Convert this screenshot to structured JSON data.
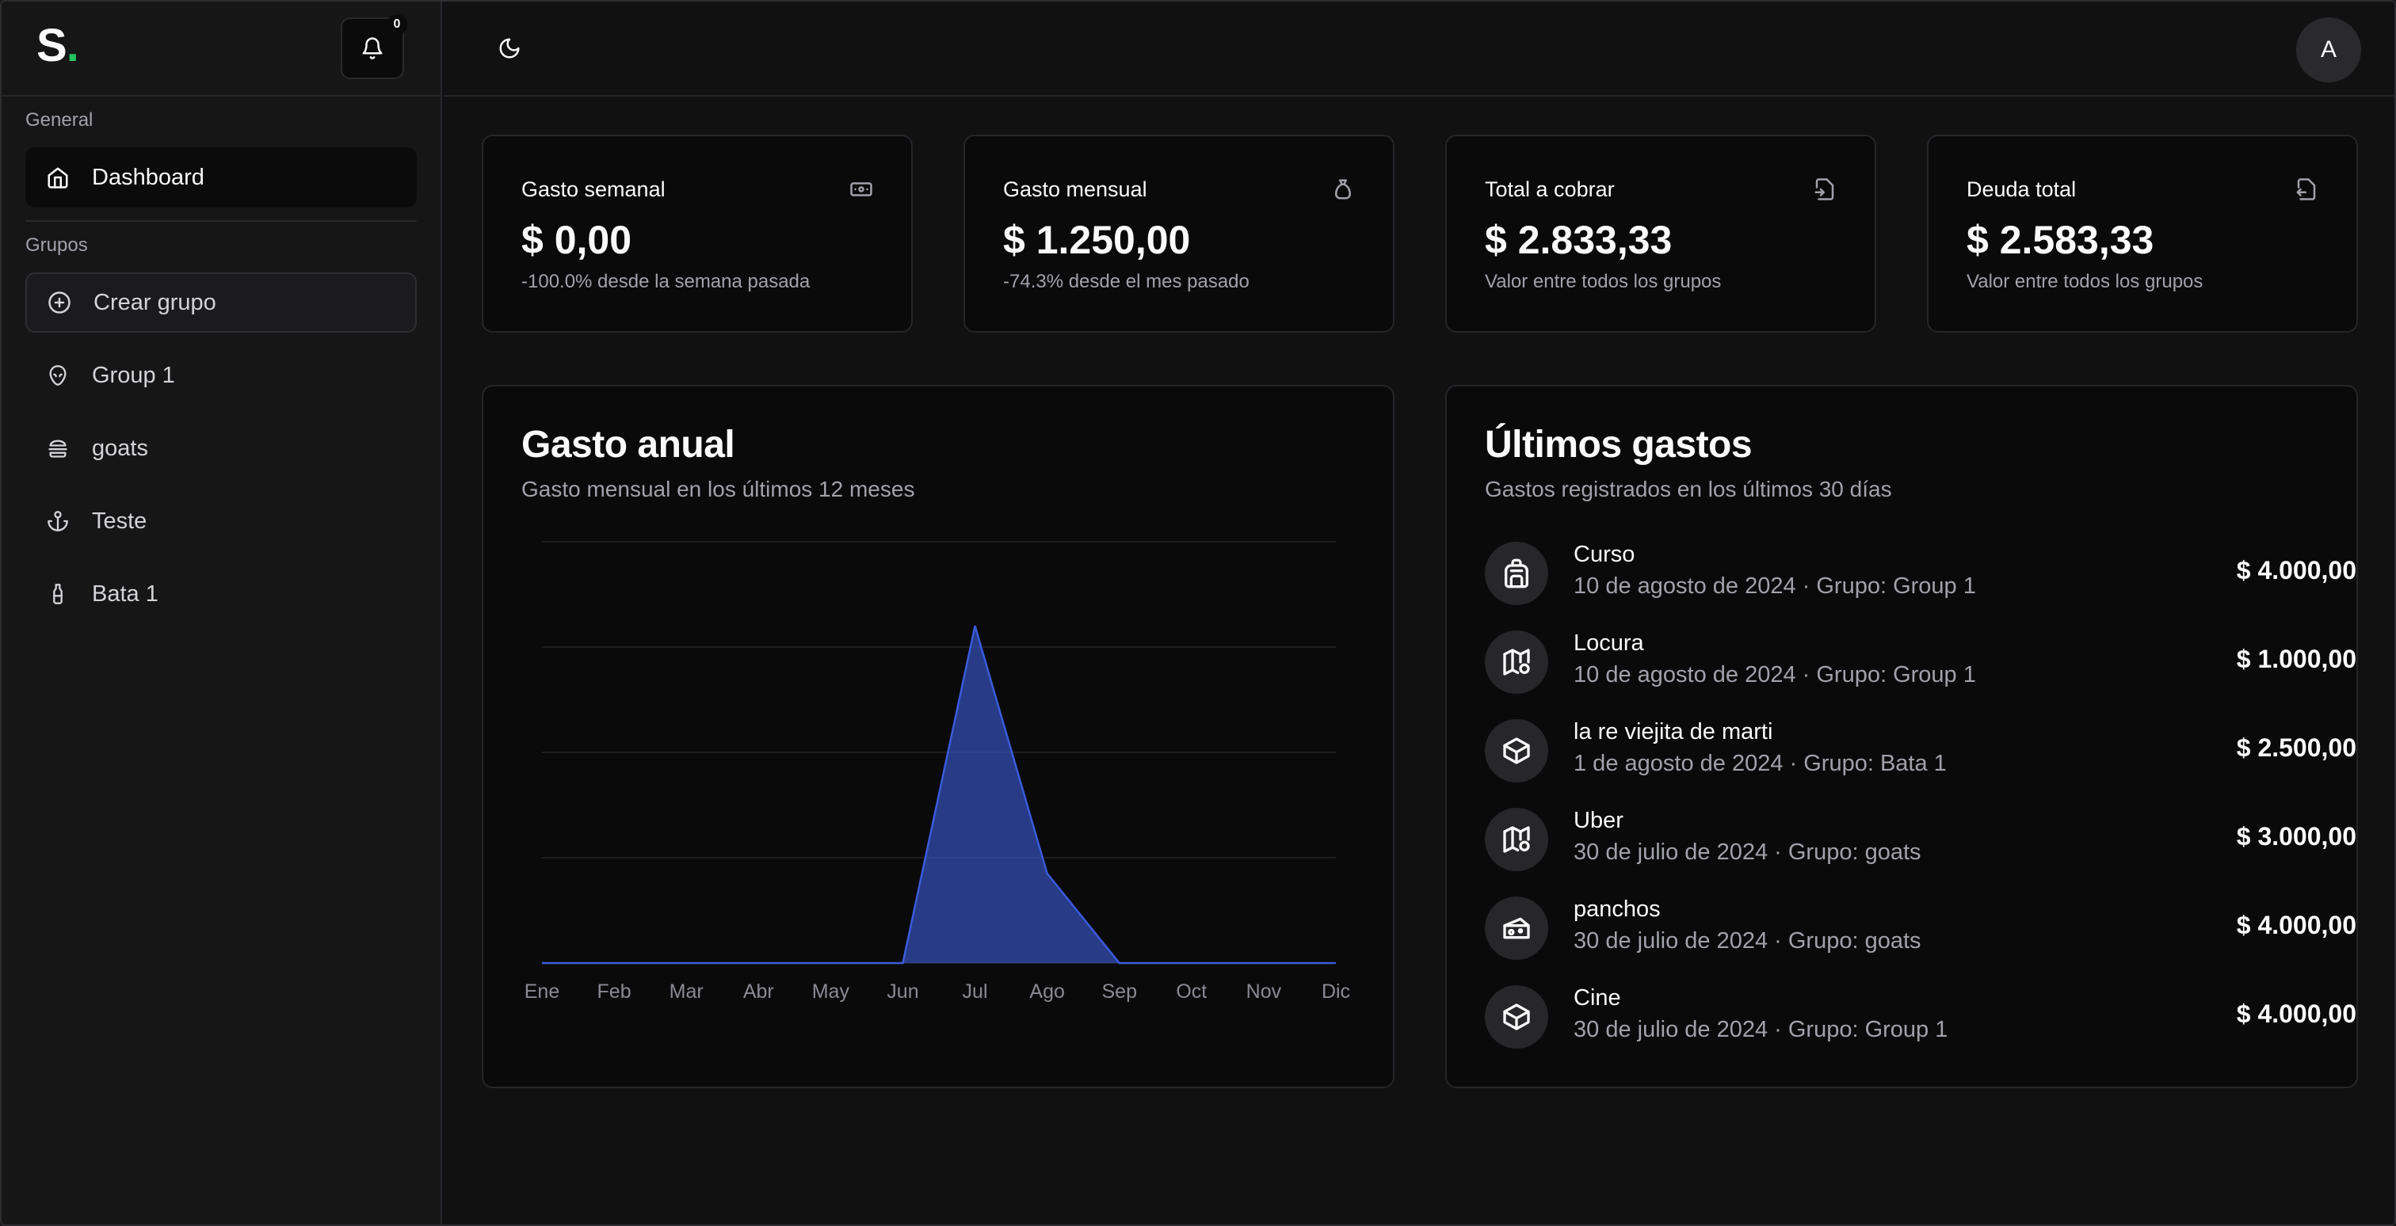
{
  "app": {
    "logo_letter": "S",
    "logo_dot": ".",
    "accent": "#22c55e"
  },
  "notifications": {
    "icon": "bell-icon",
    "count": "0"
  },
  "sidebar": {
    "section_general": "General",
    "dashboard": {
      "label": "Dashboard",
      "icon": "home-icon"
    },
    "section_groups": "Grupos",
    "create_group": {
      "label": "Crear grupo",
      "icon": "plus-circle-icon"
    },
    "groups": [
      {
        "label": "Group 1",
        "icon": "alien-icon"
      },
      {
        "label": "goats",
        "icon": "hamburger-icon"
      },
      {
        "label": "Teste",
        "icon": "anchor-icon"
      },
      {
        "label": "Bata 1",
        "icon": "bottle-icon"
      }
    ]
  },
  "topbar": {
    "theme_icon": "moon-icon",
    "avatar_initial": "A"
  },
  "stats": [
    {
      "title": "Gasto semanal",
      "value": "$ 0,00",
      "sub": "-100.0% desde la semana pasada",
      "icon": "banknote-icon"
    },
    {
      "title": "Gasto mensual",
      "value": "$ 1.250,00",
      "sub": "-74.3% desde el mes pasado",
      "icon": "money-bag-icon"
    },
    {
      "title": "Total a cobrar",
      "value": "$ 2.833,33",
      "sub": "Valor entre todos los grupos",
      "icon": "arrow-in-icon"
    },
    {
      "title": "Deuda total",
      "value": "$ 2.583,33",
      "sub": "Valor entre todos los grupos",
      "icon": "arrow-out-icon"
    }
  ],
  "annual": {
    "title": "Gasto anual",
    "subtitle": "Gasto mensual en los últimos 12 meses"
  },
  "chart_data": {
    "type": "area",
    "title": "Gasto anual",
    "categories": [
      "Ene",
      "Feb",
      "Mar",
      "Abr",
      "May",
      "Jun",
      "Jul",
      "Ago",
      "Sep",
      "Oct",
      "Nov",
      "Dic"
    ],
    "values": [
      0,
      0,
      0,
      0,
      0,
      0,
      16000,
      4250,
      0,
      0,
      0,
      0
    ],
    "ylim": [
      0,
      20000
    ],
    "grid": true,
    "color": "#3b5bdb"
  },
  "recent": {
    "title": "Últimos gastos",
    "subtitle": "Gastos registrados en los últimos 30 días",
    "items": [
      {
        "name": "Curso",
        "meta": "10 de agosto de 2024 · Grupo: Group 1",
        "amount": "$ 4.000,00",
        "icon": "backpack-icon"
      },
      {
        "name": "Locura",
        "meta": "10 de agosto de 2024 · Grupo: Group 1",
        "amount": "$ 1.000,00",
        "icon": "map-pin-icon"
      },
      {
        "name": "la re viejita de marti",
        "meta": "1 de agosto de 2024 · Grupo: Bata 1",
        "amount": "$ 2.500,00",
        "icon": "box-icon"
      },
      {
        "name": "Uber",
        "meta": "30 de julio de 2024 · Grupo: goats",
        "amount": "$ 3.000,00",
        "icon": "map-pin-icon"
      },
      {
        "name": "panchos",
        "meta": "30 de julio de 2024 · Grupo: goats",
        "amount": "$ 4.000,00",
        "icon": "cheese-icon"
      },
      {
        "name": "Cine",
        "meta": "30 de julio de 2024 · Grupo: Group 1",
        "amount": "$ 4.000,00",
        "icon": "box-icon"
      }
    ]
  }
}
